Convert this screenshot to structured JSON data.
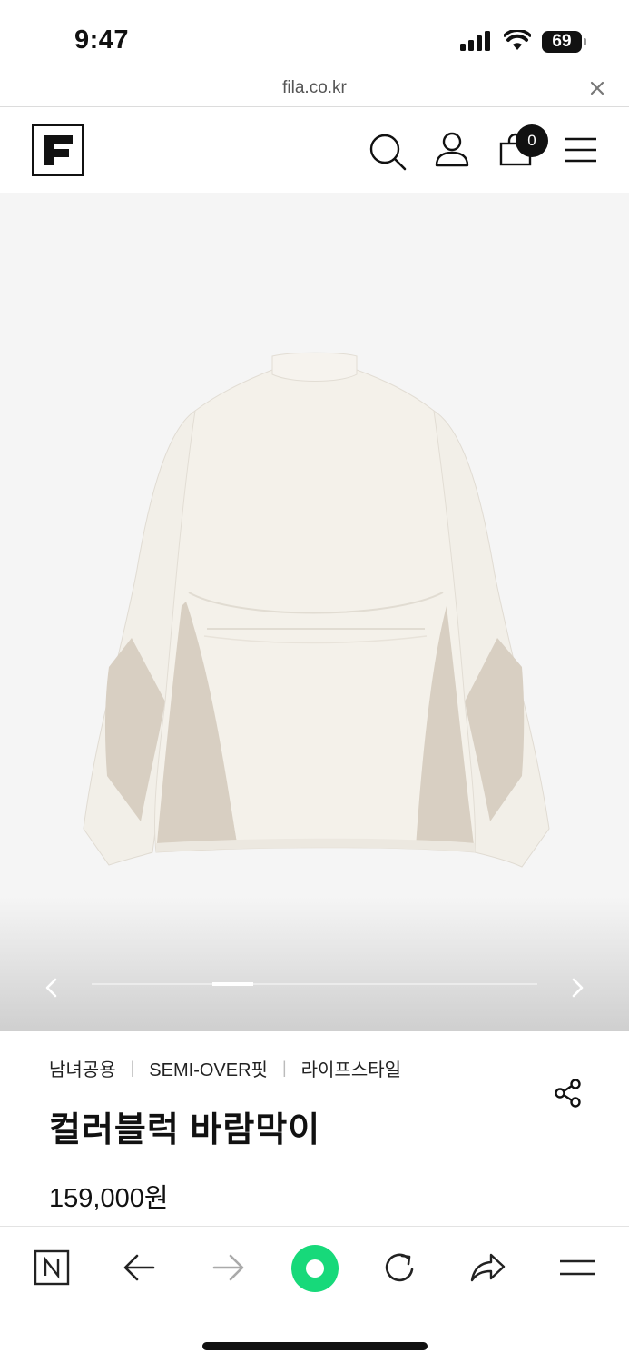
{
  "status_bar": {
    "time": "9:47",
    "battery": "69"
  },
  "browser": {
    "url": "fila.co.kr"
  },
  "header": {
    "cart_count": "0"
  },
  "product": {
    "tags": [
      "남녀공용",
      "SEMI-OVER핏",
      "라이프스타일"
    ],
    "title": "컬러블럭 바람막이",
    "price": "159,000원",
    "colors": {
      "body": "#f4f1ea",
      "panel": "#d8cfc2",
      "background": "#f5f5f5"
    }
  },
  "icons": {
    "header": [
      "fila-logo",
      "search-icon",
      "user-icon",
      "cart-icon",
      "menu-icon"
    ],
    "bottom_bar": [
      "naver-icon",
      "back-arrow-icon",
      "forward-arrow-icon",
      "green-dot-icon",
      "reload-icon",
      "share-icon",
      "menu-icon"
    ]
  }
}
